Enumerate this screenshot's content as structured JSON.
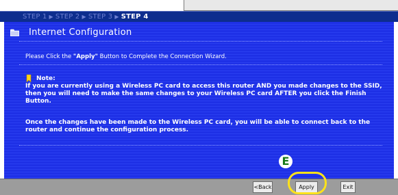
{
  "steps": [
    {
      "label": "STEP 1",
      "active": false
    },
    {
      "label": "STEP 2",
      "active": false
    },
    {
      "label": "STEP 3",
      "active": false
    },
    {
      "label": "STEP 4",
      "active": true
    }
  ],
  "step_separator": "▶",
  "header": {
    "title": "Internet Configuration",
    "icon": "folder-icon"
  },
  "instruction": {
    "prefix": "Please Click the ",
    "keyword": "\"Apply\"",
    "suffix": " Button to Complete the Connection Wizard."
  },
  "note": {
    "icon": "note-icon",
    "label": "Note:",
    "paragraph_1": "If you are currently using a Wireless PC card to access this router AND you made changes to the SSID, then you will need to make the same changes to your Wireless PC card AFTER you click the Finish Button.",
    "paragraph_2": "Once the changes have been made to the Wireless PC card, you will be able to connect back to the router and continue the configuration process."
  },
  "callout": {
    "letter": "E",
    "ring_color": "#ffe21a",
    "letter_color": "#1a7a1a"
  },
  "footer": {
    "back_label": "<Back",
    "apply_label": "Apply",
    "exit_label": "Exit"
  },
  "colors": {
    "nav_bar": "#0d2d8e",
    "panel": "#1d2ee2",
    "footer": "#9c9c9c"
  }
}
